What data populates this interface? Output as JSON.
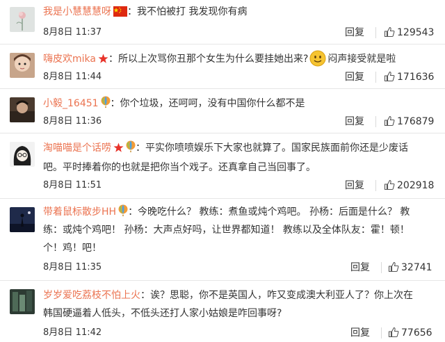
{
  "reply_label": "回复",
  "colors": {
    "username": "#eb7350",
    "text": "#333333",
    "divider": "#e6e6e6"
  },
  "comments": [
    {
      "username": "我是小慧慧慧呀",
      "badges": [
        "china-flag-icon"
      ],
      "text_lines": [
        "：我不怕被打 我发现你有病"
      ],
      "time": "8月8日 11:37",
      "likes": "129543"
    },
    {
      "username": "嗨皮欢mika",
      "badges": [
        "red-star-icon"
      ],
      "text_lines": [
        "：所以上次骂你丑那个女生为什么要挂她出来?",
        "闷声接受就是啦"
      ],
      "time": "8月8日 11:44",
      "likes": "171636"
    },
    {
      "username": "小毅_16451",
      "badges": [
        "balloon-icon"
      ],
      "text_lines": [
        "：你个垃圾，还呵呵，没有中国你什么都不是"
      ],
      "time": "8月8日 11:36",
      "likes": "176879"
    },
    {
      "username": "淘喵喵是个话唠",
      "badges": [
        "red-star-icon",
        "balloon-icon"
      ],
      "text_lines": [
        "：平实你喷喷娱乐下大家也就算了。国家民族面前你还是少废话",
        "吧。平时捧着你的也就是把你当个戏子。还真拿自己当回事了。"
      ],
      "time": "8月8日 11:51",
      "likes": "202918"
    },
    {
      "username": "带着鼠标散步HH",
      "badges": [
        "balloon-icon"
      ],
      "text_lines": [
        "：今晚吃什么？ 教练：煮鱼或炖个鸡吧。 孙杨：后面是什么？ 教",
        "练：或炖个鸡吧！ 孙杨：大声点好吗，让世界都知道！ 教练以及全体队友：霍！顿！",
        "个！鸡！吧！"
      ],
      "time": "8月8日 11:35",
      "likes": "32741"
    },
    {
      "username": "岁岁爱吃荔枝不怕上火",
      "badges": [],
      "text_lines": [
        "：诶？思聪，你不是英国人，咋又变成澳大利亚人了？你上次在",
        "韩国硬逼着人低头，不低头还打人家小姑娘是咋回事呀?"
      ],
      "time": "8月8日 11:42",
      "likes": "77656"
    }
  ]
}
